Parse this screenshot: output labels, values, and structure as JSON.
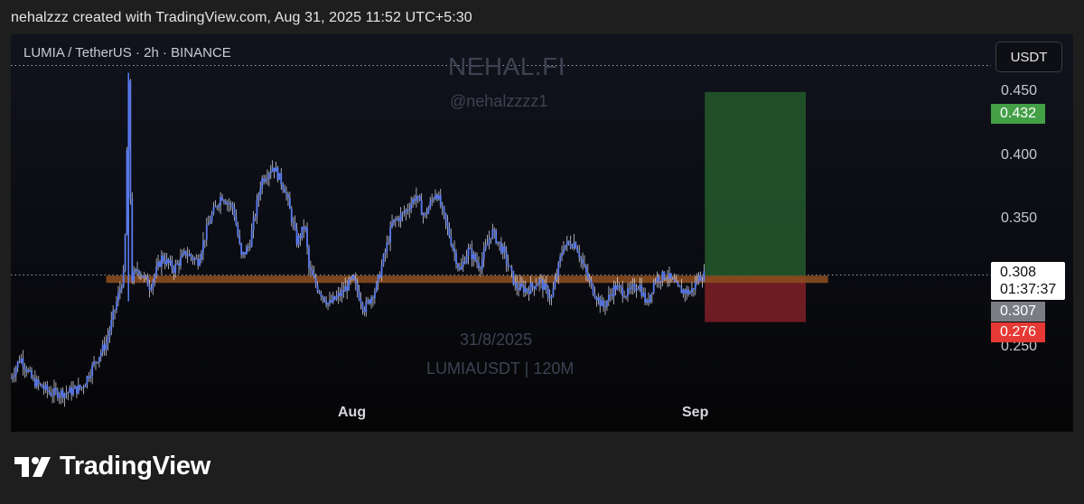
{
  "header": {
    "caption": "nehalzzz created with TradingView.com, Aug 31, 2025 11:52 UTC+5:30"
  },
  "chart": {
    "symbol": "LUMIA / TetherUS · 2h · BINANCE",
    "currency_button": "USDT",
    "watermark": {
      "title": "NEHAL.FI",
      "handle": "@nehalzzzz1",
      "date": "31/8/2025",
      "symbol": "LUMIAUSDT | 120M"
    },
    "current": {
      "price": "0.308",
      "countdown": "01:37:37"
    }
  },
  "tags": {
    "target": "0.432",
    "stop": "0.276",
    "last": "0.307"
  },
  "footer": {
    "brand": "TradingView"
  },
  "colors": {
    "candle": "#5b7cf0",
    "wick": "#e8ecff",
    "support": "#8a4b1e",
    "take_profit": "#245a2b",
    "stop_loss": "#7a1f26",
    "tag_green": "#43a047",
    "tag_red": "#e53935"
  },
  "chart_data": {
    "type": "line",
    "y_ticks": [
      "0.450",
      "0.400",
      "0.350",
      "0.250"
    ],
    "ylim": [
      0.22,
      0.465
    ],
    "x_ticks": [
      {
        "label": "Aug",
        "t": 0.4276
      },
      {
        "label": "Sep",
        "t": 0.8733
      }
    ],
    "support_level": 0.305,
    "support_range_t": [
      0.12,
      1.028
    ],
    "dotted_levels": [
      0.45,
      0.308
    ],
    "position": {
      "t_start": 0.873,
      "t_end": 1.0,
      "entry": 0.307,
      "target": 0.432,
      "stop": 0.276
    },
    "series": [
      {
        "t": [
          0,
          0.012,
          0.028,
          0.05,
          0.07,
          0.09,
          0.105,
          0.12,
          0.13,
          0.138,
          0.143,
          0.148,
          0.152,
          0.16,
          0.175,
          0.19,
          0.205,
          0.22,
          0.235,
          0.25,
          0.265,
          0.28,
          0.29,
          0.3,
          0.315,
          0.33,
          0.345,
          0.36,
          0.37,
          0.375,
          0.385,
          0.4,
          0.415,
          0.43,
          0.445,
          0.46,
          0.48,
          0.495,
          0.51,
          0.52,
          0.535,
          0.55,
          0.565,
          0.575,
          0.59,
          0.605,
          0.62,
          0.635,
          0.65,
          0.665,
          0.68,
          0.695,
          0.71,
          0.72,
          0.73,
          0.745,
          0.76,
          0.775,
          0.79,
          0.8,
          0.81,
          0.825,
          0.84,
          0.855,
          0.865,
          0.872
        ],
        "values": [
          0.238,
          0.252,
          0.236,
          0.228,
          0.228,
          0.232,
          0.248,
          0.262,
          0.283,
          0.3,
          0.31,
          0.445,
          0.305,
          0.312,
          0.3,
          0.32,
          0.312,
          0.323,
          0.317,
          0.345,
          0.362,
          0.353,
          0.32,
          0.328,
          0.372,
          0.382,
          0.366,
          0.33,
          0.342,
          0.312,
          0.3,
          0.288,
          0.295,
          0.305,
          0.285,
          0.3,
          0.343,
          0.35,
          0.362,
          0.347,
          0.365,
          0.338,
          0.31,
          0.325,
          0.314,
          0.338,
          0.323,
          0.3,
          0.298,
          0.304,
          0.292,
          0.328,
          0.33,
          0.314,
          0.3,
          0.286,
          0.3,
          0.295,
          0.302,
          0.288,
          0.305,
          0.308,
          0.298,
          0.296,
          0.306,
          0.308
        ]
      }
    ]
  }
}
